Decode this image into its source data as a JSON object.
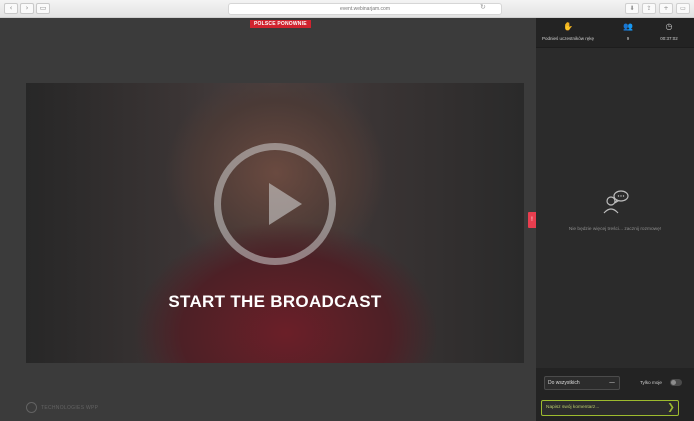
{
  "browser": {
    "nav_back": "‹",
    "nav_forward": "›",
    "nav_sidebar": "▭",
    "address": "event.webinarjam.com",
    "reload_icon": "↻",
    "tools": [
      "⬇",
      "⇪",
      "+",
      "▭"
    ]
  },
  "stage": {
    "tag": "POLSCE PONOWNIE",
    "overlay_text": "START THE BROADCAST",
    "footer_logo_text": "TECHNOLOGIES WPP"
  },
  "panel": {
    "toggle_label": "!",
    "stats": [
      {
        "icon": "hand-icon",
        "glyph": "✋",
        "label": "Podnieś uczestników rękę"
      },
      {
        "icon": "users-icon",
        "glyph": "👥",
        "label": "9"
      },
      {
        "icon": "clock-icon",
        "glyph": "◷",
        "label": "00:37:02"
      }
    ],
    "empty_text": "Nie będzie więcej treści... zacznij rozmowę!",
    "recipient": {
      "value": "Do wszystkich",
      "chevron": "—"
    },
    "only_mine_label": "Tylko moje",
    "comment_placeholder": "Napisz swój komentarz...",
    "send_icon": "❯"
  },
  "colors": {
    "accent_green": "#9dbb2e",
    "tag_red": "#d0232f",
    "panel_bg": "#2b2b2b"
  }
}
